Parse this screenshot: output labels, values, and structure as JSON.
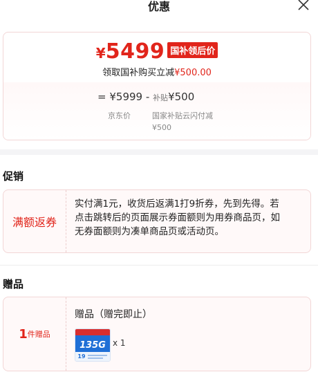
{
  "header": {
    "title": "优惠"
  },
  "price": {
    "currency": "¥",
    "amount": "5499",
    "badge": "国补领后价",
    "sub_prefix": "领取国补购买立减",
    "sub_amount": "¥500.00",
    "calc_equals": "=",
    "original_price": "¥5999",
    "minus": "-",
    "subsidy_label": "补贴",
    "subsidy_amount": "¥500",
    "original_note": "京东价",
    "subsidy_note": "国家补贴云闪付减¥500"
  },
  "promo": {
    "section_title": "促销",
    "tag": "满额返券",
    "text": "实付满1元，收货后返满1打9折券，先到先得。若点击跳转后的页面展示券面额则为用券商品页，如无券面额则为凑单商品页或活动页。"
  },
  "gift": {
    "section_title": "赠品",
    "count": "1",
    "unit": "件赠品",
    "name": "赠品（赠完即止）",
    "qty": "x 1",
    "thumb_text": "135G",
    "thumb_sub": "19"
  },
  "colors": {
    "accent": "#e1251b",
    "card_border": "#f2d6d6"
  }
}
